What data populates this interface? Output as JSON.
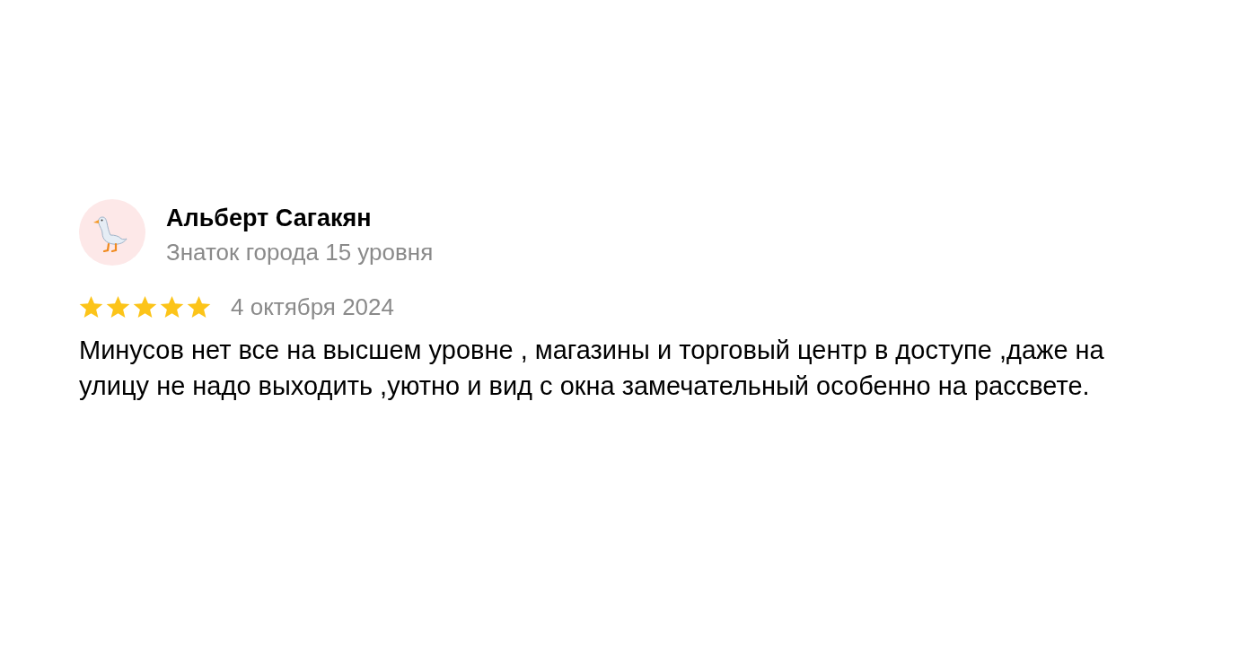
{
  "review": {
    "author": {
      "name": "Альберт Сагакян",
      "level": "Знаток города 15 уровня"
    },
    "stars": 5,
    "date": "4 октября 2024",
    "text": "Минусов нет все на высшем уровне , магазины и торговый центр в доступе ,даже на улицу не надо выходить ,уютно и вид с окна замечательный особенно на рассвете."
  }
}
